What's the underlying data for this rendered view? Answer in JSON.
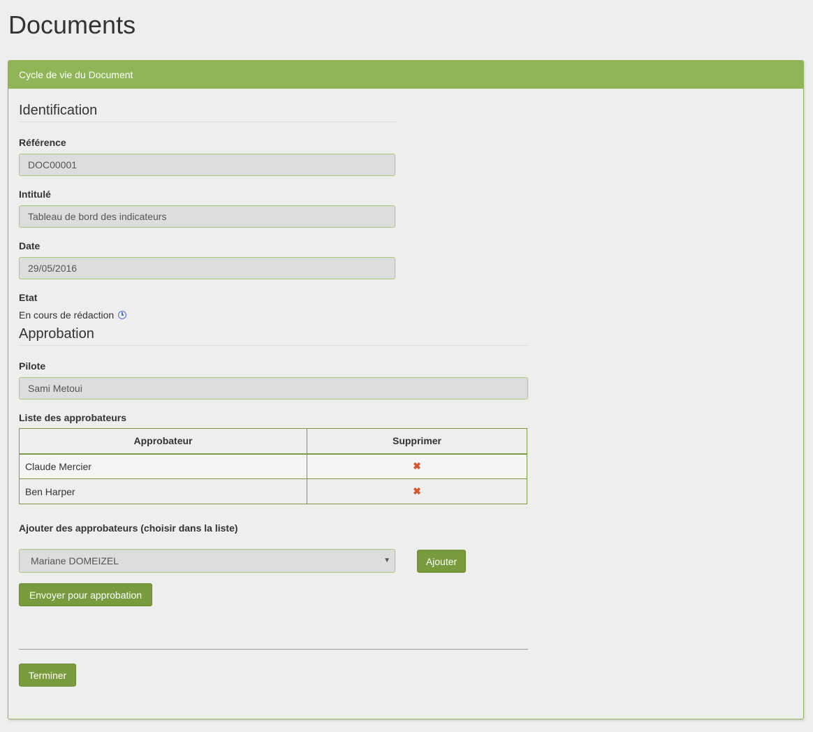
{
  "page": {
    "title": "Documents"
  },
  "panel": {
    "heading": "Cycle de vie du Document"
  },
  "identification": {
    "title": "Identification",
    "reference_label": "Référence",
    "reference_value": "DOC00001",
    "intitule_label": "Intitulé",
    "intitule_value": "Tableau de bord des indicateurs",
    "date_label": "Date",
    "date_value": "29/05/2016",
    "etat_label": "Etat",
    "etat_value": "En cours de rédaction",
    "etat_icon": "clock-icon"
  },
  "approbation": {
    "title": "Approbation",
    "pilote_label": "Pilote",
    "pilote_value": "Sami Metoui",
    "list_label": "Liste des approbateurs",
    "table": {
      "headers": [
        "Approbateur",
        "Supprimer"
      ],
      "rows": [
        {
          "name": "Claude Mercier",
          "action_icon": "remove-icon",
          "action_glyph": "✖"
        },
        {
          "name": "Ben Harper",
          "action_icon": "remove-icon",
          "action_glyph": "✖"
        }
      ]
    },
    "add_label": "Ajouter des approbateurs (choisir dans la liste)",
    "select_value": "Mariane DOMEIZEL",
    "add_button": "Ajouter",
    "send_button": "Envoyer pour approbation",
    "finish_button": "Terminer"
  },
  "colors": {
    "accent": "#8fb556",
    "button": "#7a9b3d",
    "remove": "#d9532c"
  }
}
